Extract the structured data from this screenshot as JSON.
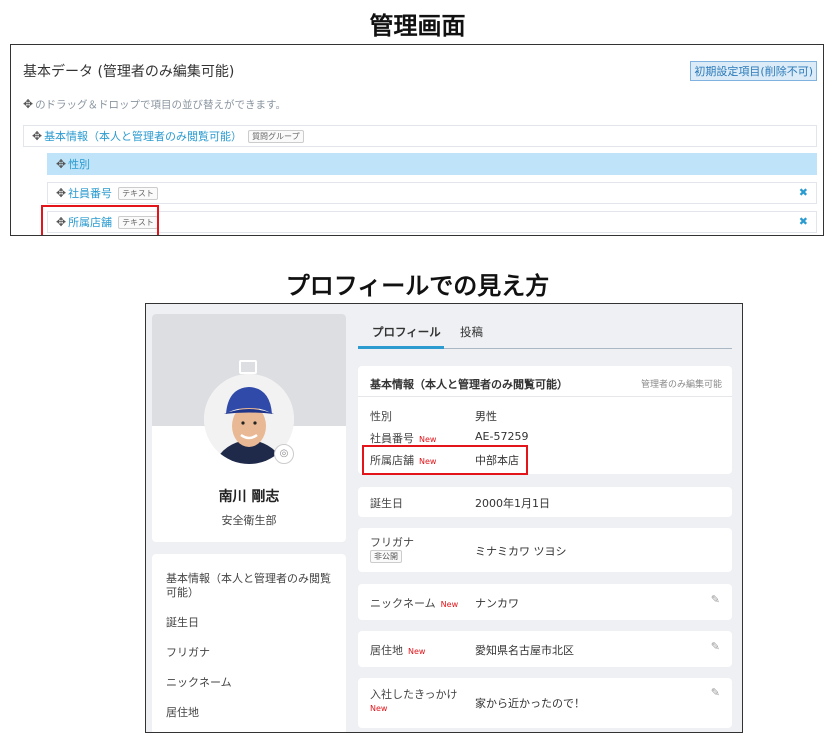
{
  "headings": {
    "admin": "管理画面",
    "profile": "プロフィールでの見え方"
  },
  "admin": {
    "title": "基本データ (管理者のみ編集可能)",
    "init_button": "初期設定項目(削除不可)",
    "hint": "のドラッグ＆ドロップで項目の並び替えができます。",
    "group": {
      "label": "基本情報（本人と管理者のみ閲覧可能）",
      "badge": "質問グループ"
    },
    "items": [
      {
        "label": "性別",
        "badge": ""
      },
      {
        "label": "社員番号",
        "badge": "テキスト"
      },
      {
        "label": "所属店舗",
        "badge": "テキスト"
      }
    ],
    "icons": {
      "move": "move-cross-icon",
      "remove": "close-x-icon"
    }
  },
  "profile": {
    "name": "南川 剛志",
    "department": "安全衛生部",
    "tabs": [
      "プロフィール",
      "投稿"
    ],
    "nav": [
      "基本情報（本人と管理者のみ閲覧可能）",
      "誕生日",
      "フリガナ",
      "ニックネーム",
      "居住地"
    ],
    "basic_section": {
      "title": "基本情報（本人と管理者のみ閲覧可能）",
      "note": "管理者のみ編集可能",
      "fields": [
        {
          "label": "性別",
          "value": "男性"
        },
        {
          "label": "社員番号",
          "value": "AE-57259",
          "new": "New"
        },
        {
          "label": "所属店舗",
          "value": "中部本店",
          "new": "New"
        }
      ]
    },
    "birthday": {
      "label": "誕生日",
      "value": "2000年1月1日"
    },
    "furigana": {
      "label": "フリガナ",
      "private": "非公開",
      "value": "ミナミカワ ツヨシ"
    },
    "nickname": {
      "label": "ニックネーム",
      "new": "New",
      "value": "ナンカワ"
    },
    "residence": {
      "label": "居住地",
      "new": "New",
      "value": "愛知県名古屋市北区"
    },
    "reason": {
      "label": "入社したきっかけ",
      "new": "New",
      "value": "家から近かったので！"
    },
    "icons": {
      "edit": "pencil-icon",
      "camera": "camera-icon",
      "image": "image-icon"
    },
    "colors": {
      "accent": "#2b9bd0",
      "new_badge": "#e3141a",
      "highlight_box": "#e3141a"
    }
  }
}
